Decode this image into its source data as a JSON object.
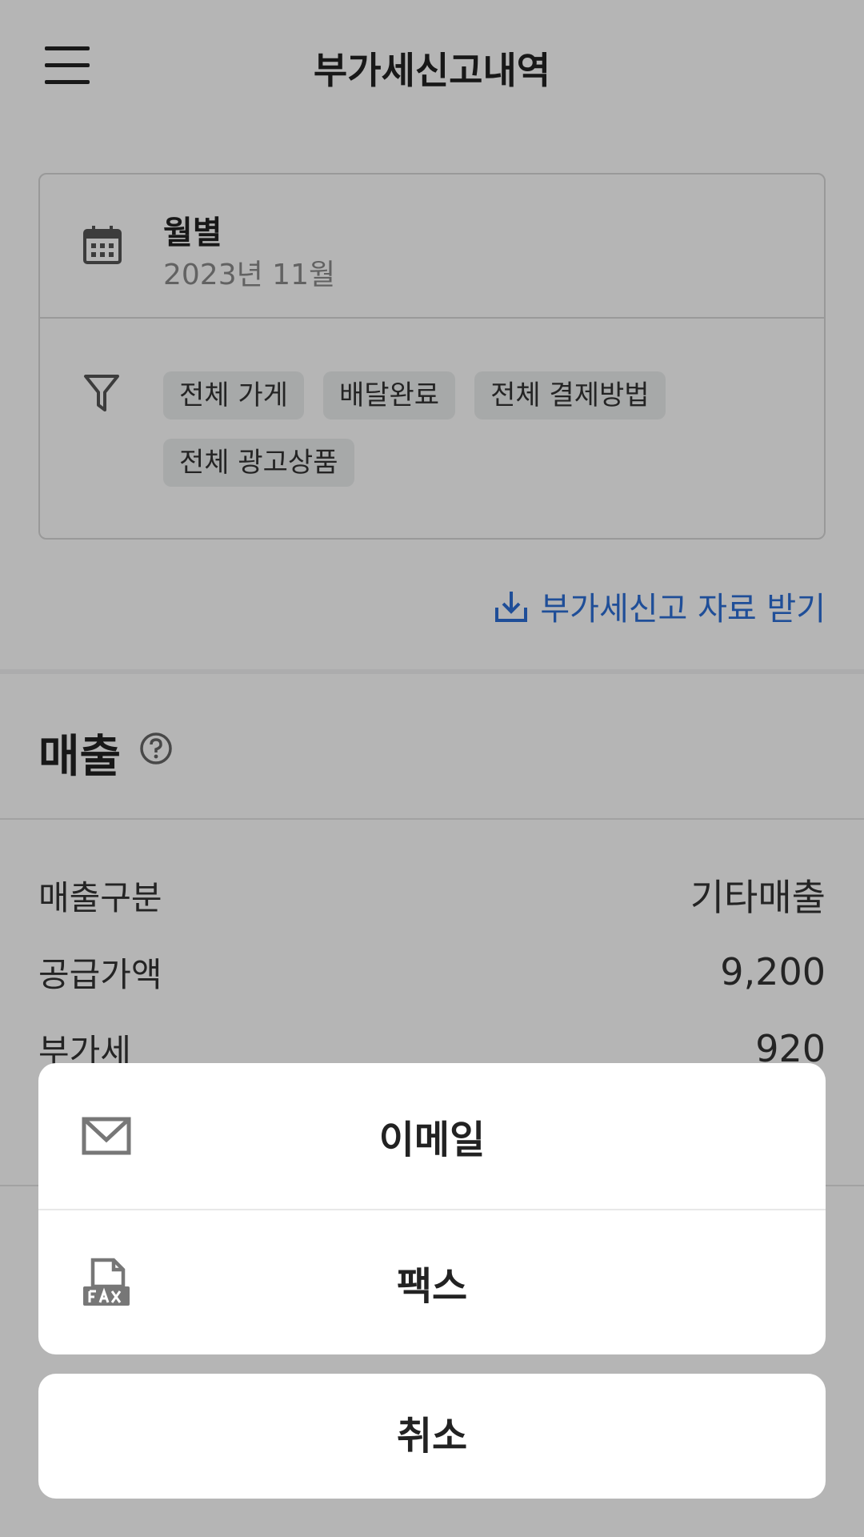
{
  "header": {
    "title": "부가세신고내역",
    "menu_icon": "hamburger-menu-icon"
  },
  "filters": {
    "period_label": "월별",
    "period_value": "2023년 11월",
    "chips": [
      "전체 가게",
      "배달완료",
      "전체 결제방법",
      "전체 광고상품"
    ]
  },
  "download_link": {
    "label": "부가세신고 자료 받기",
    "icon": "download-icon",
    "color": "#2c6fd6"
  },
  "sales": {
    "title": "매출",
    "help_icon": "question-circle-icon",
    "rows": [
      {
        "label": "매출구분",
        "value": "기타매출"
      },
      {
        "label": "공급가액",
        "value": "9,200"
      },
      {
        "label": "부가세",
        "value": "920"
      }
    ]
  },
  "action_sheet": {
    "items": [
      {
        "label": "이메일",
        "icon": "mail-icon"
      },
      {
        "label": "팩스",
        "icon": "fax-icon"
      }
    ],
    "cancel_label": "취소"
  }
}
